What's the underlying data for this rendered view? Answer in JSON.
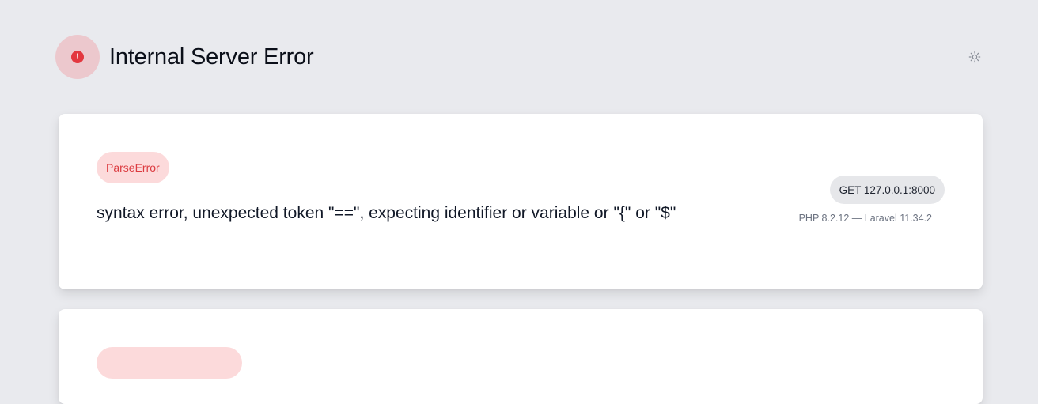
{
  "header": {
    "error_icon": "exclamation-icon",
    "error_icon_glyph": "!",
    "title": "Internal Server Error",
    "theme_icon": "sun-icon"
  },
  "exception": {
    "class": "ParseError",
    "message": "syntax error, unexpected token \"==\", expecting identifier or variable or \"{\" or \"$\"",
    "request": "GET 127.0.0.1:8000",
    "versions": "PHP 8.2.12 — Laravel 11.34.2"
  },
  "colors": {
    "background": "#e9eaee",
    "error_red": "#e3373f",
    "badge_bg": "#fcdadb",
    "badge_text": "#dc3b40"
  }
}
